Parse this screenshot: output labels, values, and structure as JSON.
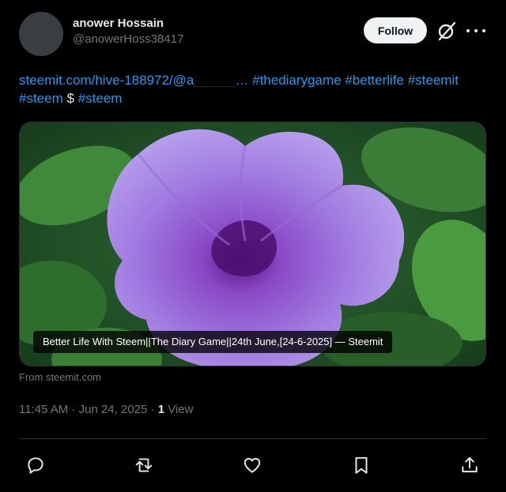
{
  "author": {
    "name": "anower Hossain",
    "handle": "@anowerHoss38417"
  },
  "header": {
    "follow_label": "Follow",
    "icons": [
      "grok-icon",
      "more-icon"
    ]
  },
  "tweet": {
    "link_text": "steemit.com/hive-188972/@a",
    "ellipsis": "…",
    "hashtags_line1": [
      "#thediarygame",
      "#betterlife",
      "#steemit"
    ],
    "line2": {
      "tag_a": "#steem",
      "cashtag": "$",
      "tag_b": "#steem"
    }
  },
  "card": {
    "caption": "Better Life With Steem||The Diary Game||24th June,[24-6-2025] — Steemit",
    "source": "From steemit.com",
    "image_subject": "purple-flower-photo"
  },
  "meta": {
    "time": "11:45 AM",
    "date": "Jun 24, 2025",
    "separator": "·",
    "view_count": "1",
    "view_label": "View"
  },
  "actions": [
    "reply-icon",
    "retweet-icon",
    "like-icon",
    "bookmark-icon",
    "share-icon"
  ],
  "colors": {
    "background": "#000000",
    "link": "#1d9bf0",
    "muted": "#71767b",
    "text": "#e7e9ea"
  }
}
